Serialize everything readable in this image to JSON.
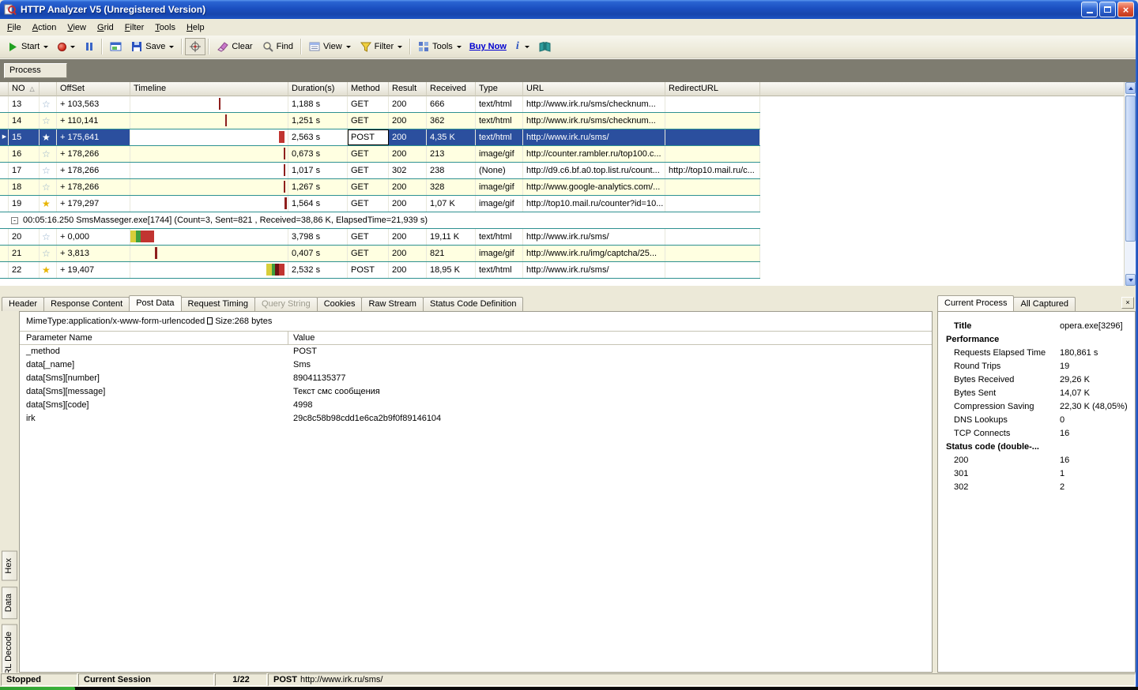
{
  "colors": {
    "selection": "#2B4F9E",
    "row_alt": "#FFFFE1",
    "grid_line": "#2E9191",
    "titlebar_blue": "#1C54C4",
    "group_bar_gray": "#7E7C70"
  },
  "window": {
    "title": "HTTP Analyzer V5  (Unregistered Version)"
  },
  "menu": {
    "items": [
      "File",
      "Action",
      "View",
      "Grid",
      "Filter",
      "Tools",
      "Help"
    ]
  },
  "toolbar": {
    "start": "Start",
    "save": "Save",
    "clear": "Clear",
    "find": "Find",
    "view": "View",
    "filter": "Filter",
    "tools": "Tools",
    "buy_now": "Buy Now",
    "info": "i"
  },
  "process_bar": {
    "group_label": "Process"
  },
  "grid": {
    "columns": [
      "NO",
      "",
      "OffSet",
      "Timeline",
      "Duration(s)",
      "Method",
      "Result",
      "Received",
      "Type",
      "URL",
      "RedirectURL"
    ],
    "rows": [
      {
        "no": "13",
        "star": "outline",
        "offset": "+ 103,563",
        "duration": "1,188 s",
        "method": "GET",
        "result": "200",
        "received": "666",
        "type": "text/html",
        "url": "http://www.irk.ru/sms/checknum...",
        "redirect": "",
        "alt": false,
        "timeline": [
          {
            "l": 112,
            "w": 2,
            "c": "#8E1F1D"
          }
        ]
      },
      {
        "no": "14",
        "star": "outline",
        "offset": "+ 110,141",
        "duration": "1,251 s",
        "method": "GET",
        "result": "200",
        "received": "362",
        "type": "text/html",
        "url": "http://www.irk.ru/sms/checknum...",
        "redirect": "",
        "alt": true,
        "timeline": [
          {
            "l": 120,
            "w": 2,
            "c": "#8E1F1D"
          }
        ]
      },
      {
        "no": "15",
        "star": "white",
        "selected": true,
        "offset": "+ 175,641",
        "duration": "2,563 s",
        "method": "POST",
        "result": "200",
        "received": "4,35 K",
        "type": "text/html",
        "url": "http://www.irk.ru/sms/",
        "redirect": "",
        "timeline": [
          {
            "l": 188,
            "w": 7,
            "c": "#C13431"
          }
        ]
      },
      {
        "no": "16",
        "star": "outline",
        "offset": "+ 178,266",
        "duration": "0,673 s",
        "method": "GET",
        "result": "200",
        "received": "213",
        "type": "image/gif",
        "url": "http://counter.rambler.ru/top100.c...",
        "redirect": "",
        "alt": true,
        "timeline": [
          {
            "l": 194,
            "w": 2,
            "c": "#8E1F1D"
          }
        ]
      },
      {
        "no": "17",
        "star": "outline",
        "offset": "+ 178,266",
        "duration": "1,017 s",
        "method": "GET",
        "result": "302",
        "received": "238",
        "type": "(None)",
        "url": "http://d9.c6.bf.a0.top.list.ru/count...",
        "redirect": "http://top10.mail.ru/c...",
        "alt": false,
        "timeline": [
          {
            "l": 194,
            "w": 2,
            "c": "#8E1F1D"
          }
        ]
      },
      {
        "no": "18",
        "star": "outline",
        "offset": "+ 178,266",
        "duration": "1,267 s",
        "method": "GET",
        "result": "200",
        "received": "328",
        "type": "image/gif",
        "url": "http://www.google-analytics.com/...",
        "redirect": "",
        "alt": true,
        "timeline": [
          {
            "l": 194,
            "w": 2,
            "c": "#8E1F1D"
          }
        ]
      },
      {
        "no": "19",
        "star": "gold",
        "offset": "+ 179,297",
        "duration": "1,564 s",
        "method": "GET",
        "result": "200",
        "received": "1,07 K",
        "type": "image/gif",
        "url": "http://top10.mail.ru/counter?id=10...",
        "redirect": "",
        "alt": false,
        "timeline": [
          {
            "l": 195,
            "w": 3,
            "c": "#8E1F1D"
          }
        ]
      },
      {
        "group": true,
        "label": "00:05:16.250   SmsMasseger.exe[1744]  (Count=3, Sent=821 , Received=38,86 K, ElapsedTime=21,939 s)"
      },
      {
        "no": "20",
        "star": "outline",
        "offset": "+ 0,000",
        "duration": "3,798 s",
        "method": "GET",
        "result": "200",
        "received": "19,11 K",
        "type": "text/html",
        "url": "http://www.irk.ru/sms/",
        "redirect": "",
        "alt": false,
        "timeline": [
          {
            "l": 0,
            "w": 7,
            "c": "#D8CE3A"
          },
          {
            "l": 7,
            "w": 6,
            "c": "#3F9E3F"
          },
          {
            "l": 13,
            "w": 17,
            "c": "#C13431"
          }
        ]
      },
      {
        "no": "21",
        "star": "outline",
        "offset": "+ 3,813",
        "duration": "0,407 s",
        "method": "GET",
        "result": "200",
        "received": "821",
        "type": "image/gif",
        "url": "http://www.irk.ru/img/captcha/25...",
        "redirect": "",
        "alt": true,
        "timeline": [
          {
            "l": 31,
            "w": 3,
            "c": "#8E1F1D"
          }
        ]
      },
      {
        "no": "22",
        "star": "gold",
        "offset": "+ 19,407",
        "duration": "2,532 s",
        "method": "POST",
        "result": "200",
        "received": "18,95 K",
        "type": "text/html",
        "url": "http://www.irk.ru/sms/",
        "redirect": "",
        "alt": false,
        "timeline": [
          {
            "l": 172,
            "w": 7,
            "c": "#D8CE3A"
          },
          {
            "l": 179,
            "w": 4,
            "c": "#3F9E3F"
          },
          {
            "l": 183,
            "w": 5,
            "c": "#6E1414"
          },
          {
            "l": 188,
            "w": 7,
            "c": "#C13431"
          }
        ]
      }
    ]
  },
  "bottom_tabs": [
    {
      "label": "Header"
    },
    {
      "label": "Response Content"
    },
    {
      "label": "Post Data",
      "active": true
    },
    {
      "label": "Request Timing"
    },
    {
      "label": "Query String",
      "disabled": true
    },
    {
      "label": "Cookies"
    },
    {
      "label": "Raw Stream"
    },
    {
      "label": "Status Code Definition"
    }
  ],
  "post_data": {
    "mime": "MimeType:application/x-www-form-urlencoded",
    "size": "Size:268 bytes",
    "columns": [
      "Parameter Name",
      "Value"
    ],
    "params": [
      {
        "name": "_method",
        "value": "POST"
      },
      {
        "name": "data[_name]",
        "value": "Sms"
      },
      {
        "name": "data[Sms][number]",
        "value": "89041135377"
      },
      {
        "name": "data[Sms][message]",
        "value": "Текст смс сообщения"
      },
      {
        "name": "data[Sms][code]",
        "value": "4998"
      },
      {
        "name": "irk",
        "value": "29c8c58b98cdd1e6ca2b9f0f89146104"
      }
    ]
  },
  "side_tabs": [
    "Hex",
    "Data",
    "URL Decode"
  ],
  "right_panel": {
    "tabs": [
      {
        "label": "Current Process",
        "active": true
      },
      {
        "label": "All Captured"
      }
    ],
    "close_label": "×",
    "rows": [
      {
        "label": "Title",
        "value": "opera.exe[3296]",
        "bold": true,
        "indent": 1
      },
      {
        "label": "Performance",
        "value": "",
        "bold": true,
        "indent": 0
      },
      {
        "label": "Requests Elapsed Time",
        "value": "180,861 s",
        "indent": 1
      },
      {
        "label": "Round Trips",
        "value": "19",
        "indent": 1
      },
      {
        "label": "Bytes Received",
        "value": "29,26 K",
        "indent": 1
      },
      {
        "label": "Bytes Sent",
        "value": "14,07 K",
        "indent": 1
      },
      {
        "label": "Compression Saving",
        "value": "22,30 K (48,05%)",
        "indent": 1
      },
      {
        "label": "DNS Lookups",
        "value": "0",
        "indent": 1
      },
      {
        "label": "TCP Connects",
        "value": "16",
        "indent": 1
      },
      {
        "label": "Status code (double-...",
        "value": "",
        "bold": true,
        "indent": 0
      },
      {
        "label": "200",
        "value": "16",
        "indent": 1
      },
      {
        "label": "301",
        "value": "1",
        "indent": 1
      },
      {
        "label": "302",
        "value": "2",
        "indent": 1
      }
    ]
  },
  "status_bar": {
    "state": "Stopped",
    "session": "Current Session",
    "position": "1/22",
    "method": "POST",
    "url": "http://www.irk.ru/sms/"
  }
}
